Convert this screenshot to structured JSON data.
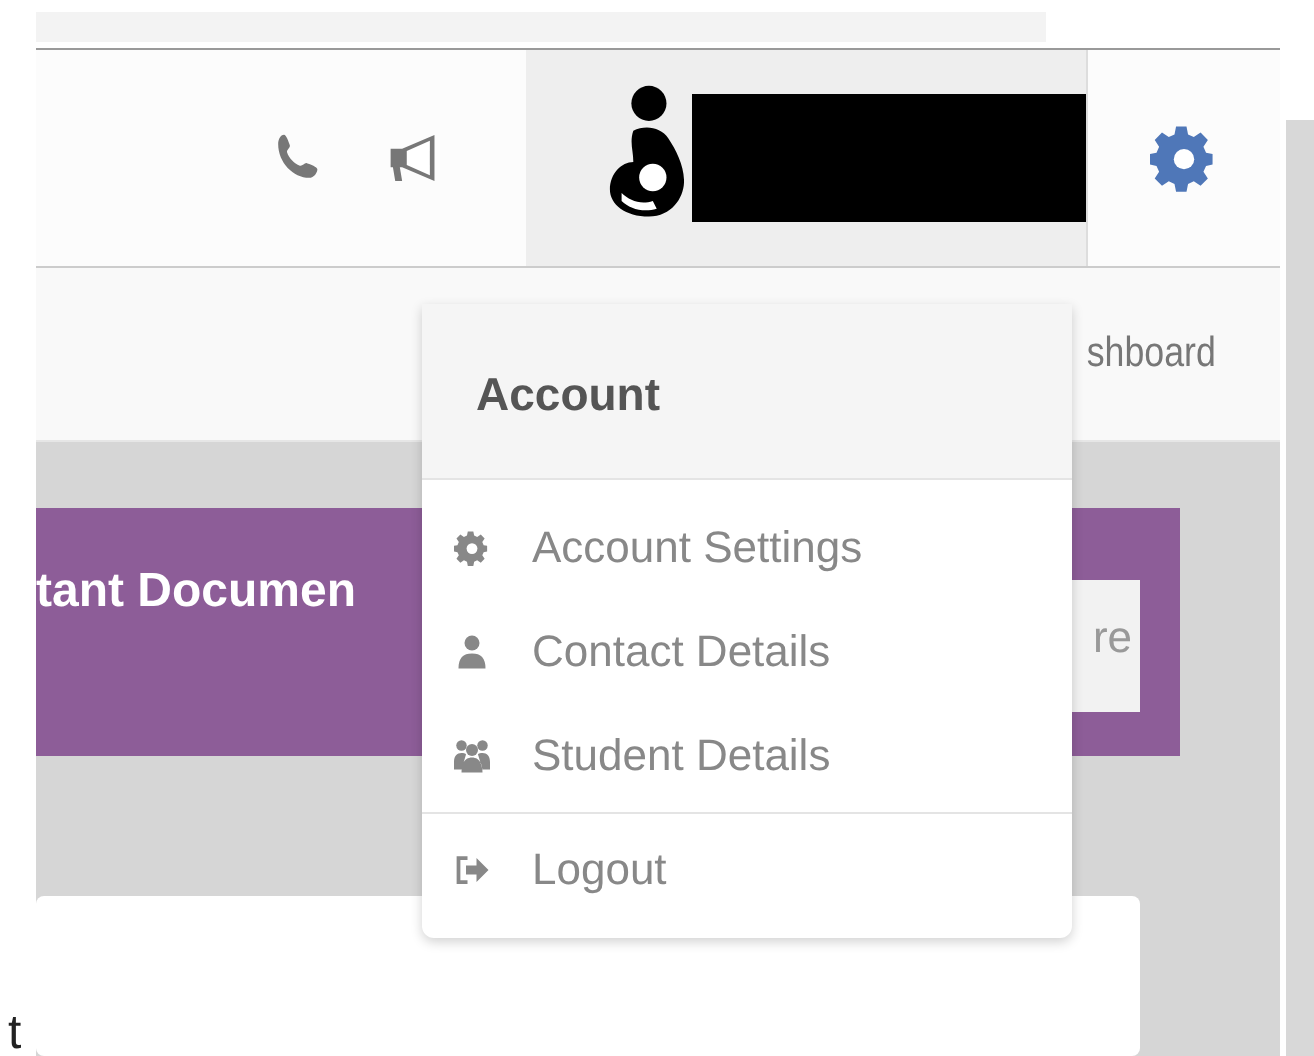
{
  "user_menu": {
    "open": true
  },
  "breadcrumb": {
    "text": "shboard"
  },
  "banner": {
    "title": "tant Documen",
    "button": "re"
  },
  "account_menu": {
    "header": "Account",
    "items": [
      {
        "kind": "gear",
        "label": "Account Settings",
        "divider_before": false
      },
      {
        "kind": "user",
        "label": "Contact Details",
        "divider_before": false
      },
      {
        "kind": "users",
        "label": "Student Details",
        "divider_before": false
      },
      {
        "kind": "logout",
        "label": "Logout",
        "divider_before": true
      }
    ]
  },
  "content": {
    "fragment": "t"
  }
}
